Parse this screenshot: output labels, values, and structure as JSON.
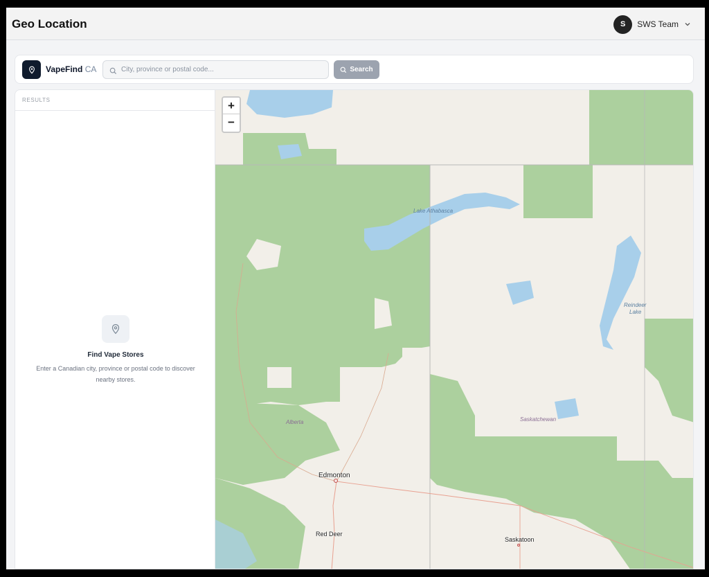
{
  "header": {
    "title": "Geo Location",
    "user": {
      "initial": "S",
      "name": "SWS Team"
    }
  },
  "search": {
    "brand_name": "VapeFind",
    "brand_suffix": "CA",
    "placeholder": "City, province or postal code...",
    "value": "",
    "button_label": "Search"
  },
  "results": {
    "header": "RESULTS",
    "empty_title": "Find Vape Stores",
    "empty_description": "Enter a Canadian city, province or postal code to discover nearby stores."
  },
  "map": {
    "zoom_in": "+",
    "zoom_out": "−",
    "labels": {
      "lake_athabasca": "Lake Athabasca",
      "reindeer_lake_1": "Reindeer",
      "reindeer_lake_2": "Lake",
      "alberta": "Alberta",
      "saskatchewan": "Saskatchewan",
      "edmonton": "Edmonton",
      "red_deer": "Red Deer",
      "saskatoon": "Saskatoon"
    }
  },
  "colors": {
    "forest": "#acd09e",
    "land": "#f2efe9",
    "water": "#a8cfea",
    "brand_dark": "#0f1b2d",
    "button_gray": "#9ca3af"
  }
}
